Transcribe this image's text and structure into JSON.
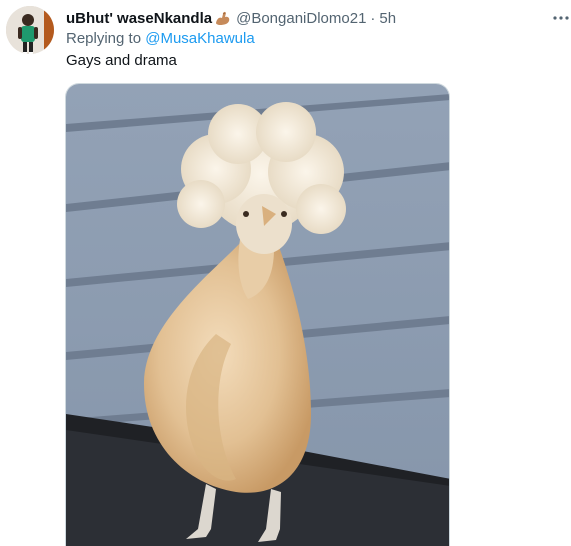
{
  "tweet": {
    "display_name": "uBhut' waseNkandla",
    "display_name_emoji": "flexed-biceps-icon",
    "handle": "@BonganiDlomo21",
    "separator": "·",
    "timestamp": "5h",
    "more_icon": "more-horizontal-icon",
    "reply_prefix": "Replying to ",
    "reply_mention": "@MusaKhawula",
    "text": "Gays and drama",
    "media_description_icon": "photo-fluffy-chicken"
  },
  "colors": {
    "text_primary": "#0f1419",
    "text_secondary": "#536471",
    "link": "#1d9bf0",
    "border": "#cfd9de"
  }
}
